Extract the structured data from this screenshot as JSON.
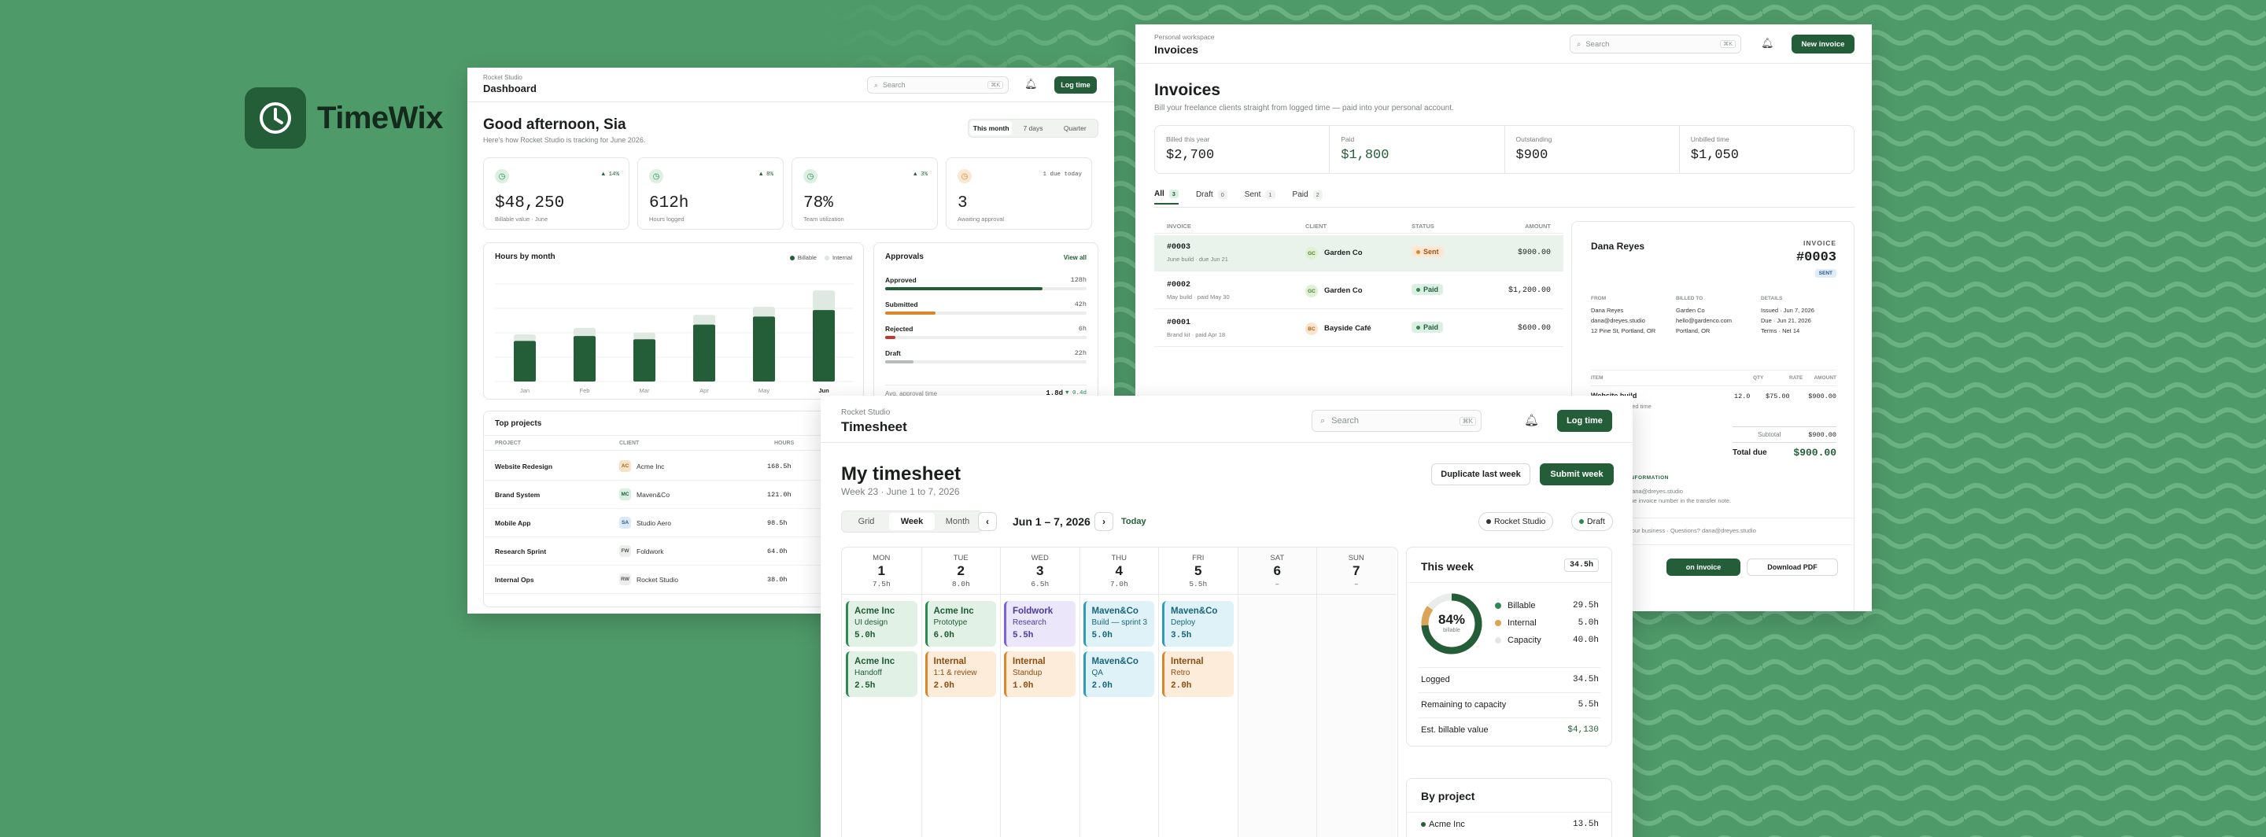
{
  "brand": {
    "name": "TimeWix"
  },
  "dashboard": {
    "workspace": "Rocket Studio",
    "title": "Dashboard",
    "search_placeholder": "Search",
    "kbd": "⌘K",
    "log_time": "Log time",
    "greeting": "Good afternoon, Sia",
    "subtitle": "Here's how Rocket Studio is tracking for June 2026.",
    "ranges": [
      "This month",
      "7 days",
      "Quarter"
    ],
    "kpis": [
      {
        "value": "$48,250",
        "label": "Billable value · June",
        "delta": "▲ 14%"
      },
      {
        "value": "612h",
        "label": "Hours logged",
        "delta": "▲ 8%"
      },
      {
        "value": "78%",
        "label": "Team utilization",
        "delta": "▲ 3%"
      },
      {
        "value": "3",
        "label": "Awaiting approval",
        "delta": "1 due today"
      }
    ],
    "hours_title": "Hours by month",
    "legend": [
      "Billable",
      "Internal"
    ],
    "chart_data": {
      "type": "bar",
      "categories": [
        "Jan",
        "Feb",
        "Mar",
        "Apr",
        "May",
        "Jun"
      ],
      "series": [
        {
          "name": "Billable",
          "values": [
            50,
            56,
            52,
            70,
            80,
            88
          ]
        },
        {
          "name": "Internal",
          "values": [
            8,
            10,
            8,
            12,
            12,
            24
          ]
        }
      ]
    },
    "approvals_title": "Approvals",
    "view_all": "View all",
    "approvals": [
      {
        "label": "Approved",
        "value": "128h",
        "fill": 0.78,
        "color": "#245e39"
      },
      {
        "label": "Submitted",
        "value": "42h",
        "fill": 0.25,
        "color": "#d9872b"
      },
      {
        "label": "Rejected",
        "value": "6h",
        "fill": 0.05,
        "color": "#c0392b"
      },
      {
        "label": "Draft",
        "value": "22h",
        "fill": 0.14,
        "color": "#b7bcb8"
      }
    ],
    "avg_label": "Avg. approval time",
    "avg_value": "1.8d",
    "avg_delta": "▼ 0.4d",
    "projects_title": "Top projects",
    "projects_cols": [
      "PROJECT",
      "CLIENT",
      "HOURS"
    ],
    "projects": [
      {
        "name": "Website Redesign",
        "initials": "AC",
        "client": "Acme Inc",
        "hours": "168.5h",
        "color": "#f6e3c7",
        "tcolor": "#a4641a"
      },
      {
        "name": "Brand System",
        "initials": "MC",
        "client": "Maven&Co",
        "hours": "121.0h",
        "color": "#d9efe2",
        "tcolor": "#245e39"
      },
      {
        "name": "Mobile App",
        "initials": "SA",
        "client": "Studio Aero",
        "hours": "98.5h",
        "color": "#dbe9f6",
        "tcolor": "#2a5a8a"
      },
      {
        "name": "Research Sprint",
        "initials": "FW",
        "client": "Foldwork",
        "hours": "64.0h",
        "color": "#eceeec",
        "tcolor": "#555"
      },
      {
        "name": "Internal Ops",
        "initials": "RW",
        "client": "Rocket Studio",
        "hours": "38.0h",
        "color": "#eceeec",
        "tcolor": "#555"
      }
    ]
  },
  "invoices": {
    "workspace": "Personal workspace",
    "title": "Invoices",
    "search_placeholder": "Search",
    "kbd": "⌘K",
    "new_invoice": "New invoice",
    "heading": "Invoices",
    "subtitle": "Bill your freelance clients straight from logged time — paid into your personal account.",
    "stats": [
      {
        "label": "Billed this year",
        "value": "$2,700",
        "color": "#1b1f1c"
      },
      {
        "label": "Paid",
        "value": "$1,800",
        "color": "#245e39"
      },
      {
        "label": "Outstanding",
        "value": "$900",
        "color": "#1b1f1c"
      },
      {
        "label": "Unbilled time",
        "value": "$1,050",
        "color": "#1b1f1c"
      }
    ],
    "tabs": [
      {
        "label": "All",
        "count": "3"
      },
      {
        "label": "Draft",
        "count": "0"
      },
      {
        "label": "Sent",
        "count": "1"
      },
      {
        "label": "Paid",
        "count": "2"
      }
    ],
    "cols": [
      "INVOICE",
      "CLIENT",
      "STATUS",
      "AMOUNT"
    ],
    "rows": [
      {
        "num": "#0003",
        "sub": "June build · due Jun 21",
        "initials": "GC",
        "client": "Garden Co",
        "status": "Sent",
        "amount": "$900.00"
      },
      {
        "num": "#0002",
        "sub": "May build · paid May 30",
        "initials": "GC",
        "client": "Garden Co",
        "status": "Paid",
        "amount": "$1,200.00"
      },
      {
        "num": "#0001",
        "sub": "Brand kit · paid Apr 18",
        "initials": "BC",
        "client": "Bayside Café",
        "status": "Paid",
        "amount": "$600.00"
      }
    ],
    "detail": {
      "from_name": "Dana Reyes",
      "invoice_label": "INVOICE",
      "number": "#0003",
      "badge": "SENT",
      "from_h": "FROM",
      "from_lines": [
        "Dana Reyes",
        "dana@dreyes.studio",
        "12 Pine St, Portland, OR"
      ],
      "billed_h": "BILLED TO",
      "billed_lines": [
        "Garden Co",
        "hello@gardenco.com",
        "Portland, OR"
      ],
      "details_h": "DETAILS",
      "details_lines": [
        "Issued · Jun 7, 2026",
        "Due · Jun 21, 2026",
        "Terms · Net 14"
      ],
      "item_cols": [
        "ITEM",
        "QTY",
        "RATE",
        "AMOUNT"
      ],
      "item_name": "Website build",
      "item_sub": "tracked time",
      "item_qty": "12.0",
      "item_rate": "$75.00",
      "item_amount": "$900.00",
      "subtotal_label": "Subtotal",
      "subtotal": "$900.00",
      "total_label": "Total due",
      "total": "$900.00",
      "pay_h": "INFORMATION",
      "pay_lines": [
        "dana@dreyes.studio",
        "the invoice number in the transfer note."
      ],
      "footer": "your business · Questions? dana@dreyes.studio",
      "primary_btn": "on invoice",
      "download_btn": "Download PDF"
    }
  },
  "timesheet": {
    "workspace": "Rocket Studio",
    "title": "Timesheet",
    "search_placeholder": "Search",
    "kbd": "⌘K",
    "log_time": "Log time",
    "heading": "My timesheet",
    "subtitle": "Week 23 · June 1 to 7, 2026",
    "duplicate": "Duplicate last week",
    "submit": "Submit week",
    "views": [
      "Grid",
      "Week",
      "Month"
    ],
    "range": "Jun 1 – 7, 2026",
    "today": "Today",
    "workspace_chip": "Rocket Studio",
    "status_chip": "Draft",
    "days": [
      {
        "dow": "MON",
        "num": "1",
        "hours": "7.5h"
      },
      {
        "dow": "TUE",
        "num": "2",
        "hours": "8.0h"
      },
      {
        "dow": "WED",
        "num": "3",
        "hours": "6.5h"
      },
      {
        "dow": "THU",
        "num": "4",
        "hours": "7.0h"
      },
      {
        "dow": "FRI",
        "num": "5",
        "hours": "5.5h"
      },
      {
        "dow": "SAT",
        "num": "6",
        "hours": "–"
      },
      {
        "dow": "SUN",
        "num": "7",
        "hours": "–"
      }
    ],
    "entries": [
      {
        "title": "Acme Inc",
        "task": "UI design",
        "hours": "5.0h",
        "day": 0,
        "slot": 0,
        "theme": "green"
      },
      {
        "title": "Acme Inc",
        "task": "Handoff",
        "hours": "2.5h",
        "day": 0,
        "slot": 1,
        "theme": "green"
      },
      {
        "title": "Acme Inc",
        "task": "Prototype",
        "hours": "6.0h",
        "day": 1,
        "slot": 0,
        "theme": "green"
      },
      {
        "title": "Internal",
        "task": "1:1 & review",
        "hours": "2.0h",
        "day": 1,
        "slot": 1,
        "theme": "orange"
      },
      {
        "title": "Foldwork",
        "task": "Research",
        "hours": "5.5h",
        "day": 2,
        "slot": 0,
        "theme": "purple"
      },
      {
        "title": "Internal",
        "task": "Standup",
        "hours": "1.0h",
        "day": 2,
        "slot": 1,
        "theme": "orange"
      },
      {
        "title": "Maven&Co",
        "task": "Build — sprint 3",
        "hours": "5.0h",
        "day": 3,
        "slot": 0,
        "theme": "cyan"
      },
      {
        "title": "Maven&Co",
        "task": "QA",
        "hours": "2.0h",
        "day": 3,
        "slot": 1,
        "theme": "cyan"
      },
      {
        "title": "Maven&Co",
        "task": "Deploy",
        "hours": "3.5h",
        "day": 4,
        "slot": 0,
        "theme": "cyan"
      },
      {
        "title": "Internal",
        "task": "Retro",
        "hours": "2.0h",
        "day": 4,
        "slot": 1,
        "theme": "orange"
      }
    ],
    "week_title": "This week",
    "week_total": "34.5h",
    "donut_pct": "84%",
    "donut_label": "billable",
    "donut_fraction": 0.84,
    "donut_legend": [
      {
        "label": "Billable",
        "value": "29.5h",
        "color": "#2e8a52"
      },
      {
        "label": "Internal",
        "value": "5.0h",
        "color": "#d9a455"
      },
      {
        "label": "Capacity",
        "value": "40.0h",
        "color": "#e3e6e3"
      }
    ],
    "stats": [
      {
        "label": "Logged",
        "value": "34.5h"
      },
      {
        "label": "Remaining to capacity",
        "value": "5.5h"
      },
      {
        "label": "Est. billable value",
        "value": "$4,130"
      }
    ],
    "by_project_title": "By project",
    "by_project": [
      {
        "label": "Acme Inc",
        "value": "13.5h"
      }
    ]
  }
}
